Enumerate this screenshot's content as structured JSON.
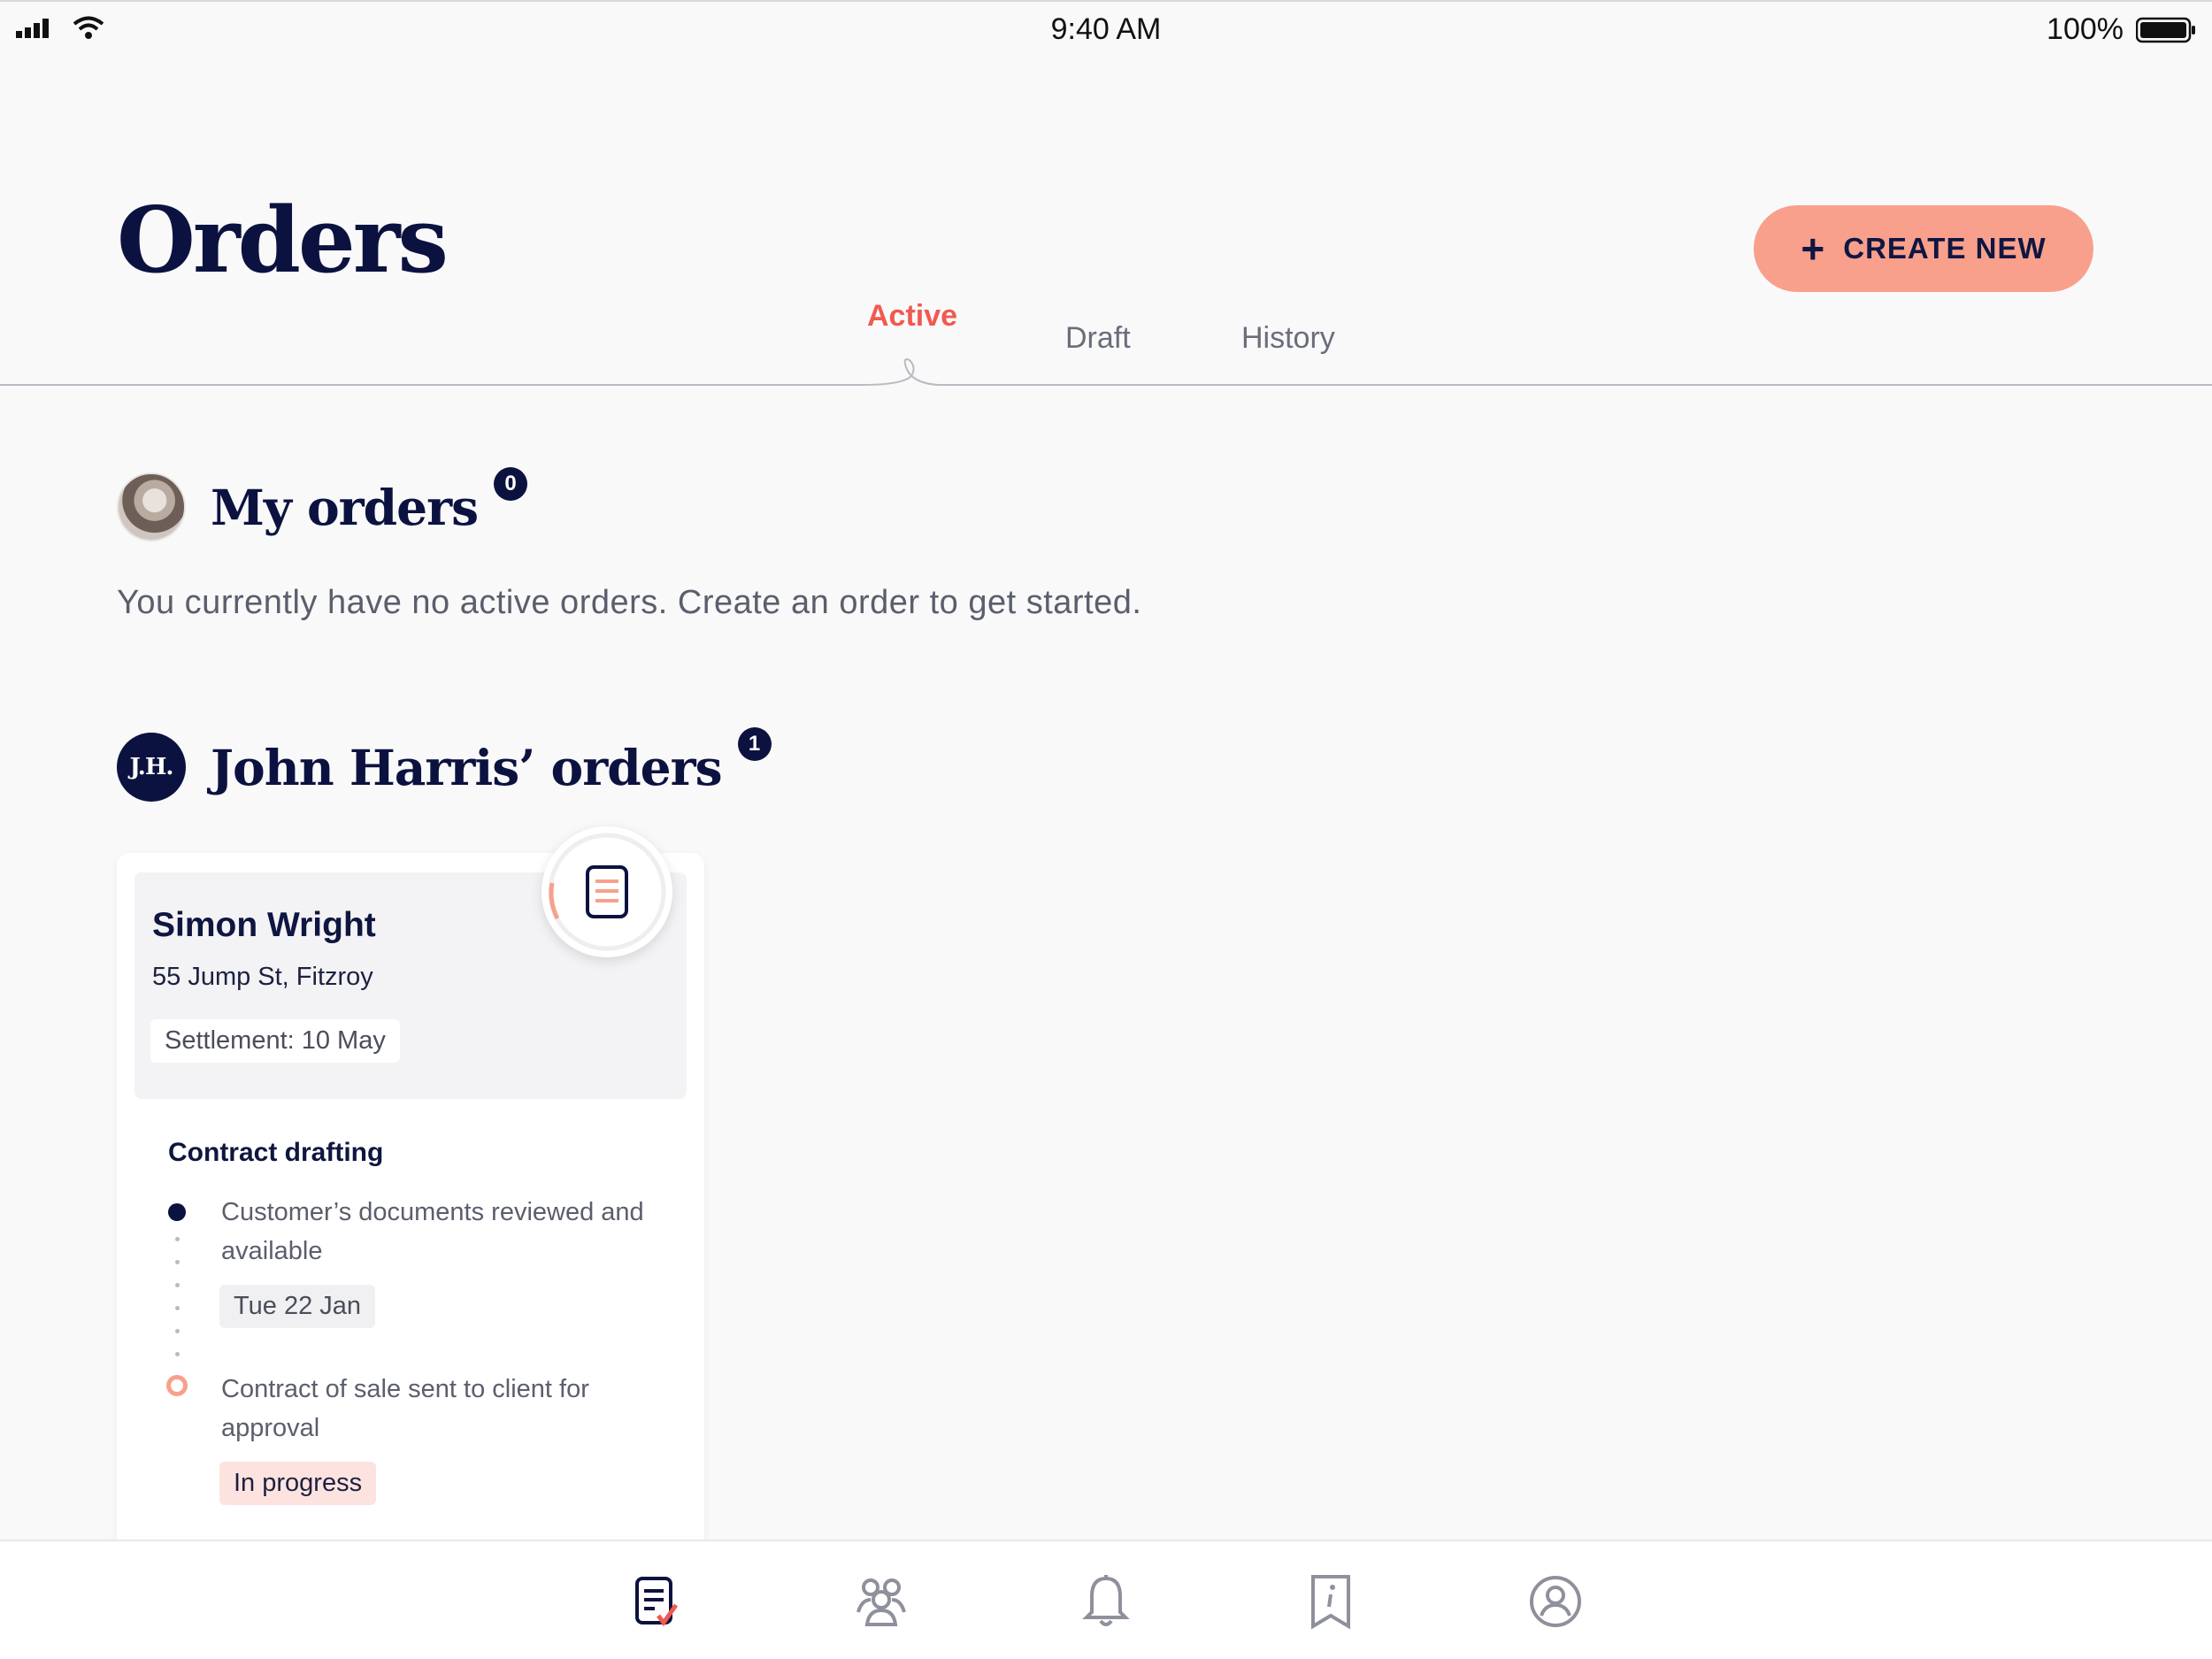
{
  "status_bar": {
    "time": "9:40 AM",
    "battery": "100%"
  },
  "header": {
    "title": "Orders",
    "create_button": "CREATE NEW"
  },
  "tabs": [
    {
      "label": "Active",
      "active": true
    },
    {
      "label": "Draft",
      "active": false
    },
    {
      "label": "History",
      "active": false
    }
  ],
  "my_orders": {
    "title": "My orders",
    "count": "0",
    "empty_message": "You currently have no active orders. Create an order to get started."
  },
  "john_orders": {
    "initials": "J.H.",
    "title": "John Harris’ orders",
    "count": "1",
    "card": {
      "client_name": "Simon Wright",
      "address": "55 Jump St, Fitzroy",
      "settlement": "Settlement: 10 May",
      "stage": "Contract drafting",
      "steps": [
        {
          "text": "Customer’s documents reviewed and available",
          "chip": "Tue 22 Jan",
          "state": "done"
        },
        {
          "text": "Contract of sale sent to client for approval",
          "chip": "In progress",
          "state": "current"
        }
      ]
    }
  },
  "bottom_nav": [
    "orders-icon",
    "team-icon",
    "notifications-icon",
    "guide-icon",
    "profile-icon"
  ],
  "colors": {
    "accent": "#f8a08c",
    "navy": "#0c1240",
    "active_tab": "#f05a50"
  }
}
